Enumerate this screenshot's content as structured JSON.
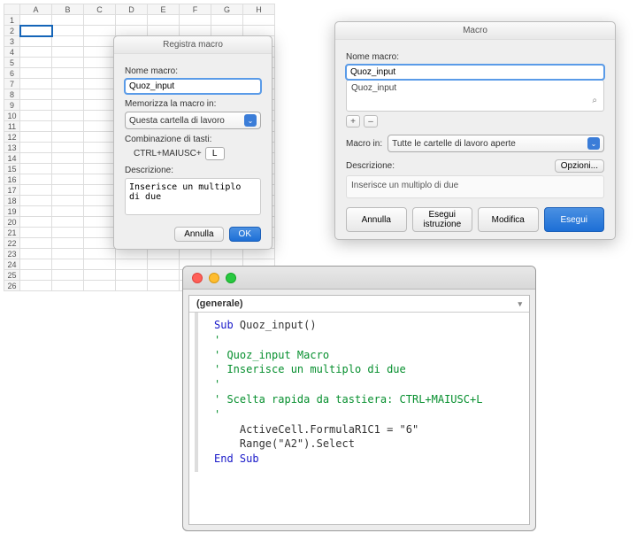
{
  "sheet": {
    "cols": [
      "A",
      "B",
      "C",
      "D",
      "E",
      "F",
      "G",
      "H"
    ],
    "rowcount": 26,
    "selected_cell": "A2"
  },
  "dlg1": {
    "title": "Registra macro",
    "name_label": "Nome macro:",
    "name_value": "Quoz_input",
    "store_label": "Memorizza la macro in:",
    "store_value": "Questa cartella di lavoro",
    "shortcut_label": "Combinazione di tasti:",
    "shortcut_prefix": "CTRL+MAIUSC+",
    "shortcut_key": "L",
    "desc_label": "Descrizione:",
    "desc_value": "Inserisce un multiplo di due",
    "cancel": "Annulla",
    "ok": "OK"
  },
  "dlg2": {
    "title": "Macro",
    "name_label": "Nome macro:",
    "name_value": "Quoz_input",
    "list_item": "Quoz_input",
    "plus": "+",
    "minus": "–",
    "macroin_label": "Macro in:",
    "macroin_value": "Tutte le cartelle di lavoro aperte",
    "desc_label": "Descrizione:",
    "options": "Opzioni...",
    "desc_value": "Inserisce un multiplo di due",
    "b_cancel": "Annulla",
    "b_step": "Esegui istruzione",
    "b_edit": "Modifica",
    "b_run": "Esegui"
  },
  "vbe": {
    "combo": "(generale)",
    "line1a": "Sub ",
    "line1b": "Quoz_input()",
    "c1": "'",
    "c2": "' Quoz_input Macro",
    "c3": "' Inserisce un multiplo di due",
    "c4": "'",
    "c5": "' Scelta rapida da tastiera: CTRL+MAIUSC+L",
    "c6": "'",
    "s1": "    ActiveCell.FormulaR1C1 = \"6\"",
    "s2": "    Range(\"A2\").Select",
    "end": "End Sub"
  }
}
